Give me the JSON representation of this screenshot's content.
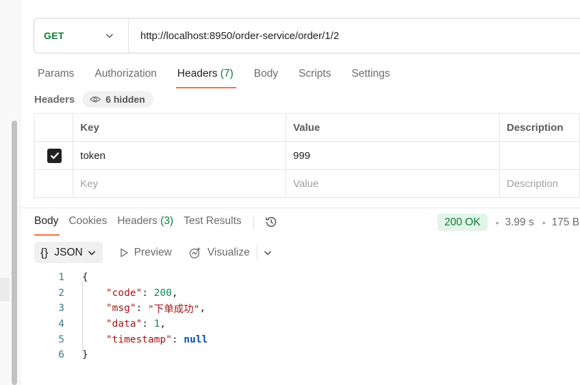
{
  "request": {
    "method": "GET",
    "url": "http://localhost:8950/order-service/order/1/2"
  },
  "request_tabs": [
    {
      "label": "Params",
      "count": ""
    },
    {
      "label": "Authorization",
      "count": ""
    },
    {
      "label": "Headers",
      "count": "(7)",
      "active": true
    },
    {
      "label": "Body",
      "count": ""
    },
    {
      "label": "Scripts",
      "count": ""
    },
    {
      "label": "Settings",
      "count": ""
    }
  ],
  "headers_section": {
    "title": "Headers",
    "hidden_label": "6 hidden",
    "columns": [
      "Key",
      "Value",
      "Description"
    ],
    "rows": [
      {
        "checked": true,
        "key": "token",
        "value": "999",
        "description": ""
      }
    ],
    "placeholder": {
      "key": "Key",
      "value": "Value",
      "description": "Description"
    }
  },
  "response_tabs": [
    {
      "label": "Body",
      "count": "",
      "active": true
    },
    {
      "label": "Cookies",
      "count": ""
    },
    {
      "label": "Headers",
      "count": "(3)"
    },
    {
      "label": "Test Results",
      "count": ""
    }
  ],
  "response_meta": {
    "status": "200 OK",
    "time": "3.99 s",
    "size": "175 B"
  },
  "view_controls": {
    "format": "JSON",
    "braces": "{}",
    "preview": "Preview",
    "visualize": "Visualize"
  },
  "colors": {
    "accent": "#ff6c37",
    "method_get": "#0f7b37",
    "status_bg": "#e2f5e8",
    "status_text": "#0a7a38"
  },
  "response_body": {
    "line_numbers": [
      "1",
      "2",
      "3",
      "4",
      "5",
      "6"
    ],
    "open_brace": "{",
    "close_brace": "}",
    "k_code": "\"code\"",
    "v_code": "200",
    "k_msg": "\"msg\"",
    "v_msg": "\"下单成功\"",
    "k_data": "\"data\"",
    "v_data": "1",
    "k_timestamp": "\"timestamp\"",
    "v_timestamp": "null"
  }
}
